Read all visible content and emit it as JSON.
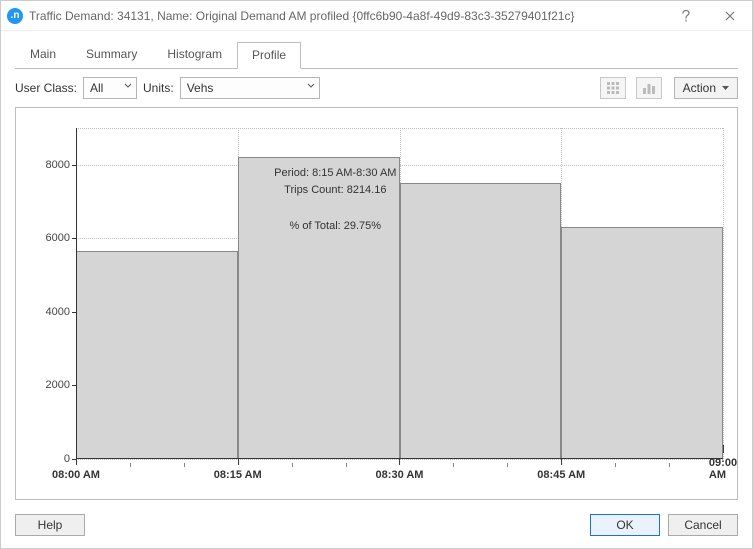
{
  "window": {
    "icon_text": ".n",
    "title": "Traffic Demand: 34131, Name: Original Demand AM profiled  {0ffc6b90-4a8f-49d9-83c3-35279401f21c}"
  },
  "tabs": [
    "Main",
    "Summary",
    "Histogram",
    "Profile"
  ],
  "active_tab": "Profile",
  "toolbar": {
    "user_class_label": "User Class:",
    "user_class_value": "All",
    "units_label": "Units:",
    "units_value": "Vehs",
    "action_label": "Action"
  },
  "tooltip": {
    "line1": "Period: 8:15 AM-8:30 AM",
    "line2": "Trips Count: 8214.16",
    "line3": "% of Total: 29.75%"
  },
  "footer": {
    "help": "Help",
    "ok": "OK",
    "cancel": "Cancel"
  },
  "chart_data": {
    "type": "bar",
    "title": "",
    "xlabel": "",
    "ylabel": "",
    "categories": [
      "08:00 AM",
      "08:15 AM",
      "08:30 AM",
      "08:45 AM",
      "09:00 AM"
    ],
    "values": [
      5650,
      8214.16,
      7500,
      6300
    ],
    "ylim": [
      0,
      9000
    ],
    "yticks": [
      0,
      2000,
      4000,
      6000,
      8000
    ],
    "xticks": [
      "08:00 AM",
      "08:15 AM",
      "08:30 AM",
      "08:45 AM",
      "09:00 AM"
    ],
    "minor_x_per_major": 2,
    "highlighted_index": 1
  }
}
